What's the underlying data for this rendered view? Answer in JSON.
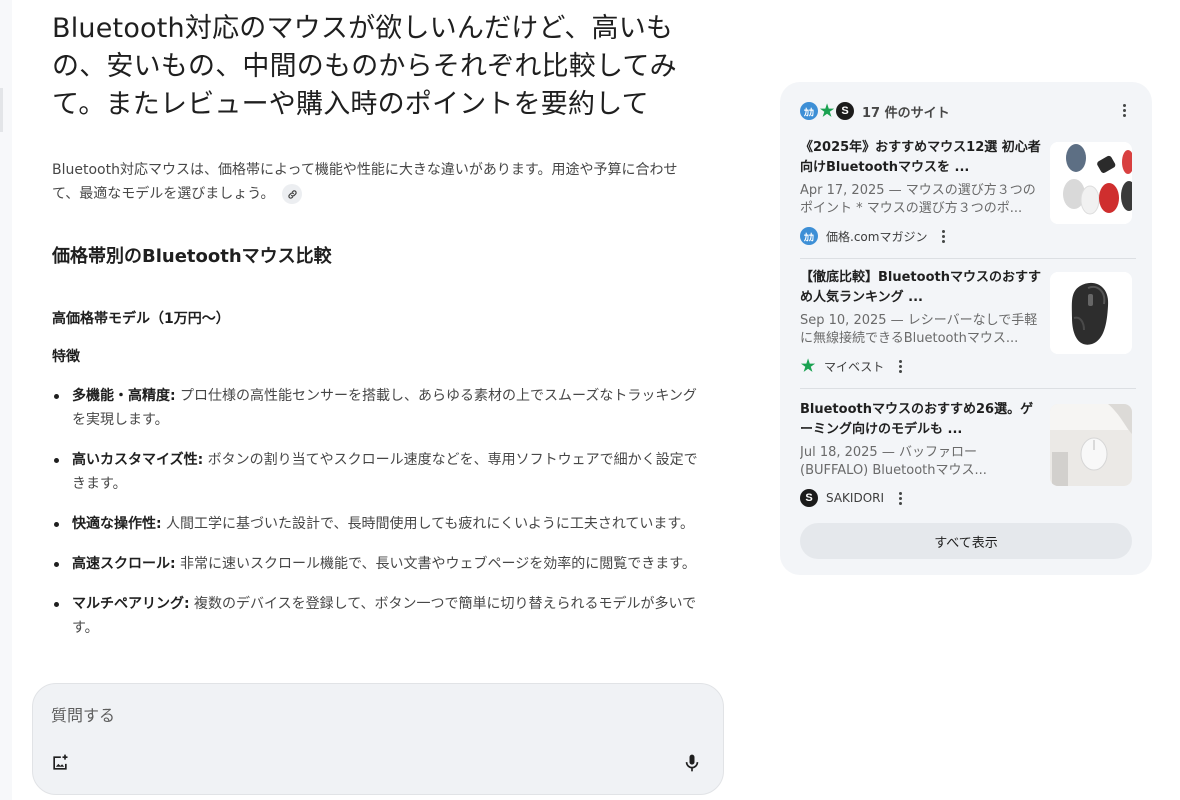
{
  "query": {
    "title": "Bluetooth対応のマウスが欲しいんだけど、高いもの、安いもの、中間のものからそれぞれ比較してみて。またレビューや購入時のポイントを要約して"
  },
  "answer": {
    "summary": "Bluetooth対応マウスは、価格帯によって機能や性能に大きな違いがあります。用途や予算に合わせて、最適なモデルを選びましょう。",
    "section_title": "価格帯別のBluetoothマウス比較",
    "tier_heading": "高価格帯モデル（1万円〜）",
    "features_heading": "特徴",
    "features": [
      {
        "term": "多機能・高精度:",
        "text": " プロ仕様の高性能センサーを搭載し、あらゆる素材の上でスムーズなトラッキングを実現します。"
      },
      {
        "term": "高いカスタマイズ性:",
        "text": " ボタンの割り当てやスクロール速度などを、専用ソフトウェアで細かく設定できます。"
      },
      {
        "term": "快適な操作性:",
        "text": " 人間工学に基づいた設計で、長時間使用しても疲れにくいように工夫されています。"
      },
      {
        "term": "高速スクロール:",
        "text": " 非常に速いスクロール機能で、長い文書やウェブページを効率的に閲覧できます。"
      },
      {
        "term": "マルチペアリング:",
        "text": " 複数のデバイスを登録して、ボタン一つで簡単に切り替えられるモデルが多いです。"
      }
    ]
  },
  "composer": {
    "placeholder": "質問する",
    "image_icon": "add-image-icon",
    "mic_icon": "mic-icon"
  },
  "sources": {
    "count_label": "17 件のサイト",
    "header_favicons": [
      {
        "icon": "kakaku-favicon",
        "glyph": "ｶｶ"
      },
      {
        "icon": "mybest-favicon",
        "glyph": "★"
      },
      {
        "icon": "sakidori-favicon",
        "glyph": "S"
      }
    ],
    "items": [
      {
        "title": "《2025年》おすすめマウス12選 初心者向けBluetoothマウスを ...",
        "snippet": "Apr 17, 2025 — マウスの選び方３つのポイント * マウスの選び方３つのポ...",
        "site": "価格.comマガジン",
        "favicon_glyph": "ｶｶ",
        "thumbnail": "assorted-mice-thumbnail"
      },
      {
        "title": "【徹底比較】Bluetoothマウスのおすすめ人気ランキング ...",
        "snippet": "Sep 10, 2025 — レシーバーなしで手軽に無線接続できるBluetoothマウス...",
        "site": "マイベスト",
        "favicon_glyph": "★",
        "thumbnail": "black-ergonomic-mouse-thumbnail"
      },
      {
        "title": "Bluetoothマウスのおすすめ26選。ゲーミング向けのモデルも ...",
        "snippet": "Jul 18, 2025 — バッファロー(BUFFALO) Bluetoothマウス...",
        "site": "SAKIDORI",
        "favicon_glyph": "S",
        "thumbnail": "white-mouse-desk-thumbnail"
      }
    ],
    "show_all_label": "すべて表示"
  },
  "colors": {
    "panel_bg": "#f3f5f8",
    "composer_bg": "#f0f2f5",
    "kakaku_blue": "#3d8fd6",
    "mybest_green": "#1aa251"
  }
}
